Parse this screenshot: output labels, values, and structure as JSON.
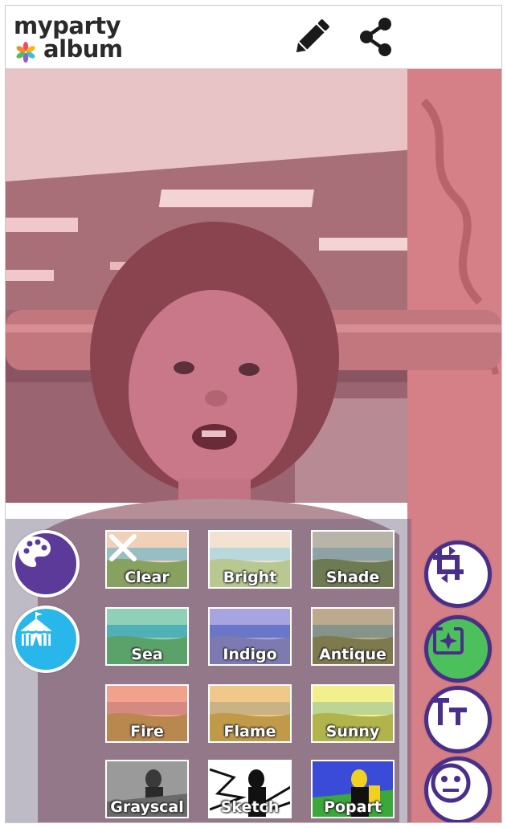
{
  "app": {
    "logo_line1": "myparty",
    "logo_line2": "album"
  },
  "header": {
    "edit_icon": "pencil-icon",
    "share_icon": "share-icon"
  },
  "filters": [
    {
      "label": "Clear",
      "tint": "#f1d0b8"
    },
    {
      "label": "Bright",
      "tint": "#f3e2d2"
    },
    {
      "label": "Shade",
      "tint": "#b9b4a8"
    },
    {
      "label": "Sea",
      "tint": "#8fd0b8"
    },
    {
      "label": "Indigo",
      "tint": "#a8a4e0"
    },
    {
      "label": "Antique",
      "tint": "#bca98e"
    },
    {
      "label": "Fire",
      "tint": "#f2a28c"
    },
    {
      "label": "Flame",
      "tint": "#f0c88a"
    },
    {
      "label": "Sunny",
      "tint": "#f2f08a"
    },
    {
      "label": "Grayscal",
      "tint": "#9a9a9a"
    },
    {
      "label": "Sketch",
      "tint": "#ffffff"
    },
    {
      "label": "Popart",
      "tint": "#3a4bd8"
    }
  ],
  "left_tools": [
    {
      "icon": "palette-icon",
      "color": "#5b3a9a"
    },
    {
      "icon": "circus-tent-icon",
      "color": "#29b6ea"
    }
  ],
  "right_tools": [
    {
      "icon": "crop-icon",
      "color": "#ffffff"
    },
    {
      "icon": "sparkle-frame-icon",
      "color": "#4cc05a"
    },
    {
      "icon": "text-icon",
      "color": "#ffffff"
    },
    {
      "icon": "emoji-face-icon",
      "color": "#ffffff"
    }
  ],
  "colors": {
    "brand_purple": "#4a2f8a",
    "photo_tint": "#e8a0a8"
  }
}
